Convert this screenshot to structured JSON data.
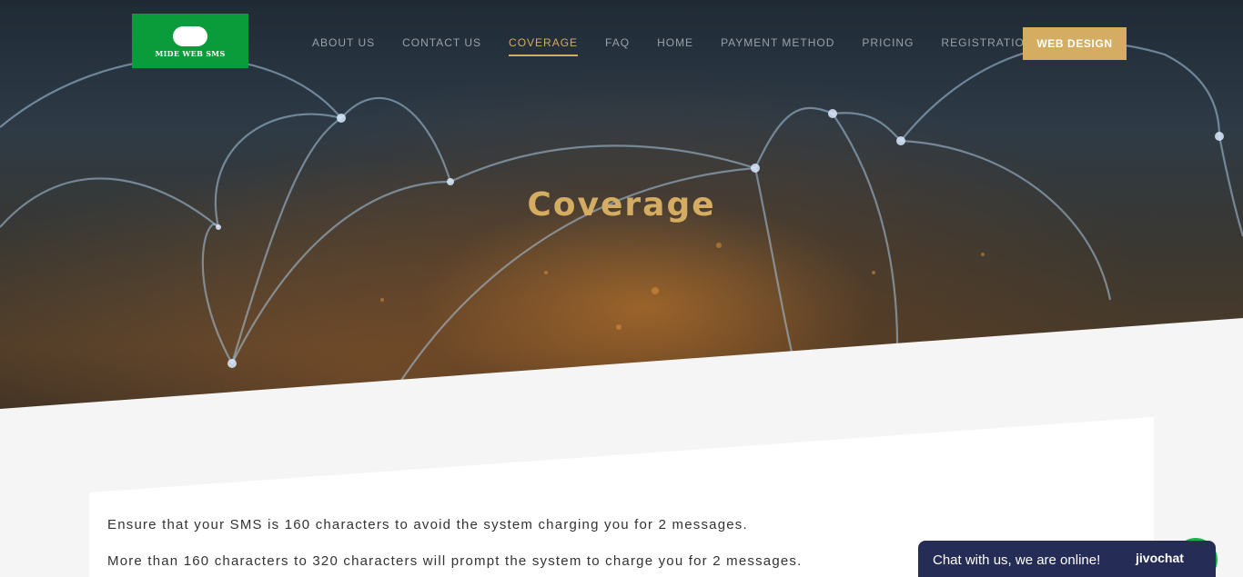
{
  "brand": {
    "logo_text": "MIDE WEB SMS",
    "logo_color": "#0a9b3a"
  },
  "nav": {
    "items": [
      {
        "label": "ABOUT US"
      },
      {
        "label": "CONTACT US"
      },
      {
        "label": "COVERAGE",
        "active": true
      },
      {
        "label": "FAQ"
      },
      {
        "label": "HOME"
      },
      {
        "label": "PAYMENT METHOD"
      },
      {
        "label": "PRICING"
      },
      {
        "label": "REGISTRATION"
      }
    ],
    "cta_label": "WEB DESIGN"
  },
  "hero": {
    "title": "Coverage"
  },
  "content": {
    "paragraphs": [
      "Ensure that your SMS is 160 characters to avoid the system charging you for 2 messages.",
      "More than 160 characters to 320 characters will prompt the system to charge you for 2 messages."
    ]
  },
  "chat": {
    "message": "Chat with us, we are online!",
    "brand": "jivochat"
  },
  "colors": {
    "accent": "#d4ac62",
    "chat_bg": "#252c55",
    "chat_badge": "#18b34c",
    "page_bg": "#f5f5f5"
  }
}
